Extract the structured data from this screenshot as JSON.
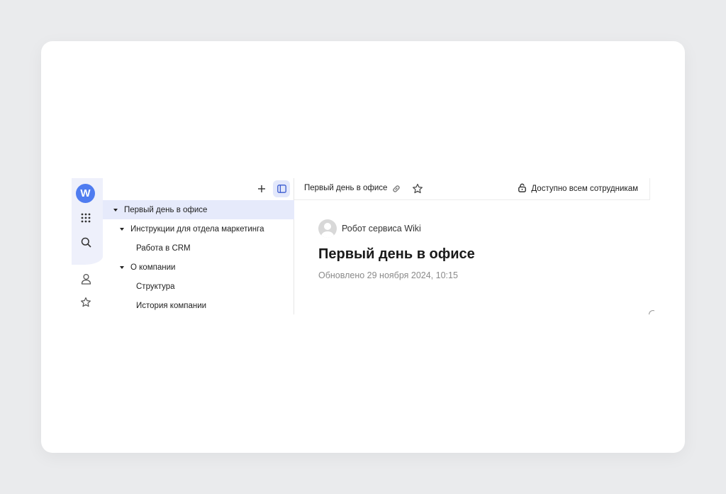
{
  "rail": {
    "logo_letter": "W",
    "icons": [
      "apps-grid-icon",
      "search-icon",
      "user-icon",
      "star-icon"
    ]
  },
  "tree_toolbar": {
    "icons": [
      "plus-icon",
      "sidebar-toggle-icon"
    ]
  },
  "tree": {
    "items": [
      {
        "label": "Первый день в офисе",
        "selected": true,
        "expanded": true
      },
      {
        "label": "Инструкции для отдела маркетинга",
        "expanded": true
      },
      {
        "label": "Работа в CRM"
      },
      {
        "label": "О компании",
        "expanded": true
      },
      {
        "label": "Структура"
      },
      {
        "label": "История компании"
      }
    ]
  },
  "topbar": {
    "page_tab": "Первый день в офисе",
    "icons": [
      "link-icon",
      "star-icon",
      "lock-icon"
    ],
    "access_label": "Доступно всем сотрудникам"
  },
  "page": {
    "author": "Робот сервиса Wiki",
    "title": "Первый день в офисе",
    "updated": "Обновлено 29 ноября 2024, 10:15"
  },
  "colors": {
    "accent": "#4f7cf0",
    "rail_bg": "#eef0fb",
    "selected_bg": "#e6eafb",
    "muted_text": "#8a8a8a"
  }
}
